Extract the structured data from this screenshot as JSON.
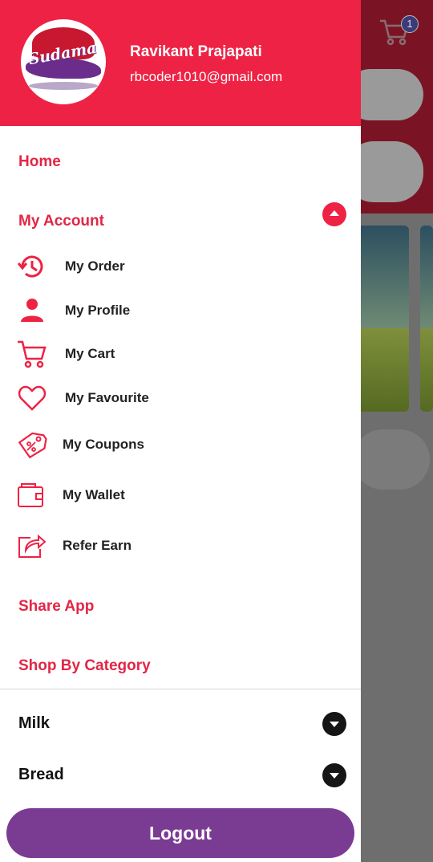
{
  "background": {
    "cart_badge": "1"
  },
  "header": {
    "logo_text": "Sudama",
    "user_name": "Ravikant Prajapati",
    "user_email": "rbcoder1010@gmail.com",
    "background_color": "#ee2244"
  },
  "menu": {
    "home": "Home",
    "my_account": "My Account",
    "account_items": [
      {
        "label": "My Order",
        "icon": "history-icon"
      },
      {
        "label": "My Profile",
        "icon": "person-icon"
      },
      {
        "label": "My Cart",
        "icon": "cart-icon"
      },
      {
        "label": "My Favourite",
        "icon": "heart-icon"
      },
      {
        "label": "My Coupons",
        "icon": "coupon-icon"
      },
      {
        "label": "My Wallet",
        "icon": "wallet-icon"
      },
      {
        "label": "Refer Earn",
        "icon": "share-icon"
      }
    ],
    "share_app": "Share App",
    "shop_by_category": "Shop By Category",
    "categories": [
      {
        "label": "Milk"
      },
      {
        "label": "Bread"
      }
    ]
  },
  "logout_label": "Logout",
  "colors": {
    "accent": "#ee2244",
    "logout": "#7a3c93"
  }
}
